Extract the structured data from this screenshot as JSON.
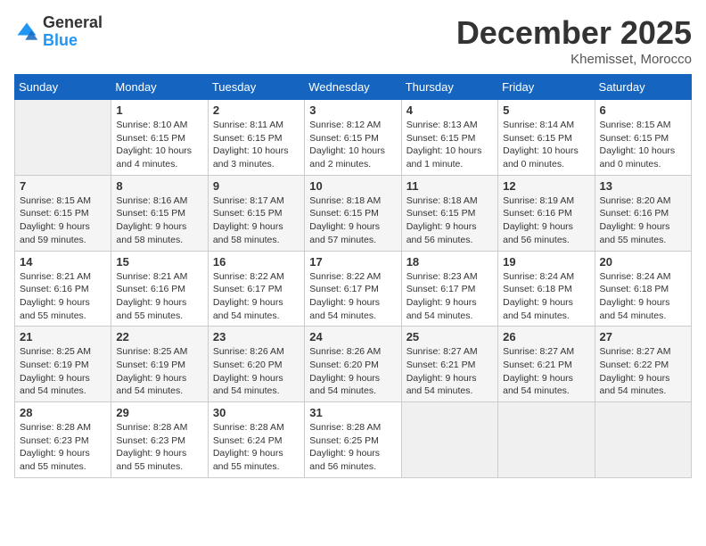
{
  "header": {
    "logo_line1": "General",
    "logo_line2": "Blue",
    "month": "December 2025",
    "location": "Khemisset, Morocco"
  },
  "weekdays": [
    "Sunday",
    "Monday",
    "Tuesday",
    "Wednesday",
    "Thursday",
    "Friday",
    "Saturday"
  ],
  "weeks": [
    [
      {
        "day": "",
        "empty": true
      },
      {
        "day": "1",
        "sunrise": "8:10 AM",
        "sunset": "6:15 PM",
        "daylight": "10 hours and 4 minutes."
      },
      {
        "day": "2",
        "sunrise": "8:11 AM",
        "sunset": "6:15 PM",
        "daylight": "10 hours and 3 minutes."
      },
      {
        "day": "3",
        "sunrise": "8:12 AM",
        "sunset": "6:15 PM",
        "daylight": "10 hours and 2 minutes."
      },
      {
        "day": "4",
        "sunrise": "8:13 AM",
        "sunset": "6:15 PM",
        "daylight": "10 hours and 1 minute."
      },
      {
        "day": "5",
        "sunrise": "8:14 AM",
        "sunset": "6:15 PM",
        "daylight": "10 hours and 0 minutes."
      },
      {
        "day": "6",
        "sunrise": "8:15 AM",
        "sunset": "6:15 PM",
        "daylight": "10 hours and 0 minutes."
      }
    ],
    [
      {
        "day": "7",
        "sunrise": "8:15 AM",
        "sunset": "6:15 PM",
        "daylight": "9 hours and 59 minutes."
      },
      {
        "day": "8",
        "sunrise": "8:16 AM",
        "sunset": "6:15 PM",
        "daylight": "9 hours and 58 minutes."
      },
      {
        "day": "9",
        "sunrise": "8:17 AM",
        "sunset": "6:15 PM",
        "daylight": "9 hours and 58 minutes."
      },
      {
        "day": "10",
        "sunrise": "8:18 AM",
        "sunset": "6:15 PM",
        "daylight": "9 hours and 57 minutes."
      },
      {
        "day": "11",
        "sunrise": "8:18 AM",
        "sunset": "6:15 PM",
        "daylight": "9 hours and 56 minutes."
      },
      {
        "day": "12",
        "sunrise": "8:19 AM",
        "sunset": "6:16 PM",
        "daylight": "9 hours and 56 minutes."
      },
      {
        "day": "13",
        "sunrise": "8:20 AM",
        "sunset": "6:16 PM",
        "daylight": "9 hours and 55 minutes."
      }
    ],
    [
      {
        "day": "14",
        "sunrise": "8:21 AM",
        "sunset": "6:16 PM",
        "daylight": "9 hours and 55 minutes."
      },
      {
        "day": "15",
        "sunrise": "8:21 AM",
        "sunset": "6:16 PM",
        "daylight": "9 hours and 55 minutes."
      },
      {
        "day": "16",
        "sunrise": "8:22 AM",
        "sunset": "6:17 PM",
        "daylight": "9 hours and 54 minutes."
      },
      {
        "day": "17",
        "sunrise": "8:22 AM",
        "sunset": "6:17 PM",
        "daylight": "9 hours and 54 minutes."
      },
      {
        "day": "18",
        "sunrise": "8:23 AM",
        "sunset": "6:17 PM",
        "daylight": "9 hours and 54 minutes."
      },
      {
        "day": "19",
        "sunrise": "8:24 AM",
        "sunset": "6:18 PM",
        "daylight": "9 hours and 54 minutes."
      },
      {
        "day": "20",
        "sunrise": "8:24 AM",
        "sunset": "6:18 PM",
        "daylight": "9 hours and 54 minutes."
      }
    ],
    [
      {
        "day": "21",
        "sunrise": "8:25 AM",
        "sunset": "6:19 PM",
        "daylight": "9 hours and 54 minutes."
      },
      {
        "day": "22",
        "sunrise": "8:25 AM",
        "sunset": "6:19 PM",
        "daylight": "9 hours and 54 minutes."
      },
      {
        "day": "23",
        "sunrise": "8:26 AM",
        "sunset": "6:20 PM",
        "daylight": "9 hours and 54 minutes."
      },
      {
        "day": "24",
        "sunrise": "8:26 AM",
        "sunset": "6:20 PM",
        "daylight": "9 hours and 54 minutes."
      },
      {
        "day": "25",
        "sunrise": "8:27 AM",
        "sunset": "6:21 PM",
        "daylight": "9 hours and 54 minutes."
      },
      {
        "day": "26",
        "sunrise": "8:27 AM",
        "sunset": "6:21 PM",
        "daylight": "9 hours and 54 minutes."
      },
      {
        "day": "27",
        "sunrise": "8:27 AM",
        "sunset": "6:22 PM",
        "daylight": "9 hours and 54 minutes."
      }
    ],
    [
      {
        "day": "28",
        "sunrise": "8:28 AM",
        "sunset": "6:23 PM",
        "daylight": "9 hours and 55 minutes."
      },
      {
        "day": "29",
        "sunrise": "8:28 AM",
        "sunset": "6:23 PM",
        "daylight": "9 hours and 55 minutes."
      },
      {
        "day": "30",
        "sunrise": "8:28 AM",
        "sunset": "6:24 PM",
        "daylight": "9 hours and 55 minutes."
      },
      {
        "day": "31",
        "sunrise": "8:28 AM",
        "sunset": "6:25 PM",
        "daylight": "9 hours and 56 minutes."
      },
      {
        "day": "",
        "empty": true
      },
      {
        "day": "",
        "empty": true
      },
      {
        "day": "",
        "empty": true
      }
    ]
  ],
  "labels": {
    "sunrise": "Sunrise:",
    "sunset": "Sunset:",
    "daylight": "Daylight:"
  }
}
